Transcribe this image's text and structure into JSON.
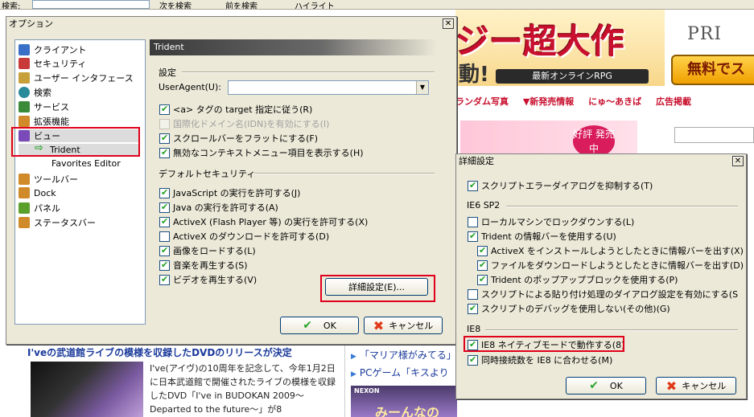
{
  "toolbar": {
    "search_label": "検索:",
    "next_label": "次を検索",
    "prev_label": "前を検索",
    "highlight_label": "ハイライト"
  },
  "background": {
    "banner_big": "ジー超大作",
    "banner_mark": "動!",
    "banner_sub": "最新オンラインRPG",
    "banner_logo": "PRI",
    "banner_free": "無料でスタ",
    "nav": [
      "ランダム写真",
      "▼新発売情報",
      "にゅ～あきば",
      "広告掲載"
    ],
    "pink_badge": "好評 発売中",
    "news_heading": "I'veの武道館ライブの模様を収録したDVDのリリースが決定",
    "news_body": "I've(アイヴ)の10周年を記念して、今年1月2日に日本武道館で開催されたライブの模様を収録したDVD「I've in BUDOKAN 2009～Departed to the future～」が8",
    "right_links": [
      "「マリア様がみてる」",
      "PCゲーム「キスより"
    ],
    "ad_brand": "NEXON",
    "ad_text": "みーんなの"
  },
  "options_dialog": {
    "title": "オプション",
    "close": "✕",
    "tree": [
      {
        "label": "クライアント",
        "color": "#3a6fc8"
      },
      {
        "label": "セキュリティ",
        "color": "#c83a3a"
      },
      {
        "label": "ユーザー インタフェース",
        "color": "#c8a03a"
      },
      {
        "label": "検索",
        "color": "#2a8a9a"
      },
      {
        "label": "サービス",
        "color": "#3a8a3a"
      },
      {
        "label": "拡張機能",
        "color": "#d08a2a"
      },
      {
        "label": "ビュー",
        "color": "#7a4ab8"
      },
      {
        "label": "Trident",
        "color": "#2ea52e"
      },
      {
        "label": "Favorites Editor",
        "color": ""
      },
      {
        "label": "ツールバー",
        "color": "#d08a2a"
      },
      {
        "label": "Dock",
        "color": "#d08a2a"
      },
      {
        "label": "パネル",
        "color": "#5aa02a"
      },
      {
        "label": "ステータスバー",
        "color": "#d08a2a"
      }
    ],
    "panel_title": "Trident",
    "settings_section": "設定",
    "useragent_label": "UserAgent(U):",
    "useragent_value": "",
    "settings": [
      {
        "label": "<a> タグの target 指定に従う(R)",
        "checked": true,
        "disabled": false
      },
      {
        "label": "国際化ドメイン名(IDN)を有効にする(I)",
        "checked": false,
        "disabled": true
      },
      {
        "label": "スクロールバーをフラットにする(F)",
        "checked": true,
        "disabled": false
      },
      {
        "label": "無効なコンテキストメニュー項目を表示する(H)",
        "checked": true,
        "disabled": false
      }
    ],
    "security_section": "デフォルトセキュリティ",
    "security": [
      {
        "label": "JavaScript の実行を許可する(J)",
        "checked": true
      },
      {
        "label": "Java の実行を許可する(A)",
        "checked": true
      },
      {
        "label": "ActiveX (Flash Player 等) の実行を許可する(X)",
        "checked": true
      },
      {
        "label": "ActiveX のダウンロードを許可する(D)",
        "checked": false
      },
      {
        "label": "画像をロードする(L)",
        "checked": true
      },
      {
        "label": "音楽を再生する(S)",
        "checked": true
      },
      {
        "label": "ビデオを再生する(V)",
        "checked": true
      }
    ],
    "advanced_button": "詳細設定(E)...",
    "ok_button": "OK",
    "cancel_button": "キャンセル"
  },
  "advanced_dialog": {
    "title": "詳細設定",
    "close": "✕",
    "top_option": {
      "label": "スクリプトエラーダイアログを抑制する(T)",
      "checked": true
    },
    "ie6_section": "IE6 SP2",
    "ie6_options": [
      {
        "label": "ローカルマシンでロックダウンする(L)",
        "checked": false
      },
      {
        "label": "Trident の情報バーを使用する(U)",
        "checked": true
      },
      {
        "label": "ActiveX をインストールしようとしたときに情報バーを出す(X)",
        "checked": true
      },
      {
        "label": "ファイルをダウンロードしようとしたときに情報バーを出す(D)",
        "checked": true
      },
      {
        "label": "Trident のポップアップブロックを使用する(P)",
        "checked": true
      },
      {
        "label": "スクリプトによる貼り付け処理のダイアログ設定を有効にする(S",
        "checked": false
      },
      {
        "label": "スクリプトのデバッグを使用しない(その他)(G)",
        "checked": true
      }
    ],
    "ie8_section": "IE8",
    "ie8_options": [
      {
        "label": "IE8 ネイティブモードで動作する(8)",
        "checked": true
      },
      {
        "label": "同時接続数を IE8 に合わせる(M)",
        "checked": true
      }
    ],
    "ok_button": "OK",
    "cancel_button": "キャンセル"
  }
}
